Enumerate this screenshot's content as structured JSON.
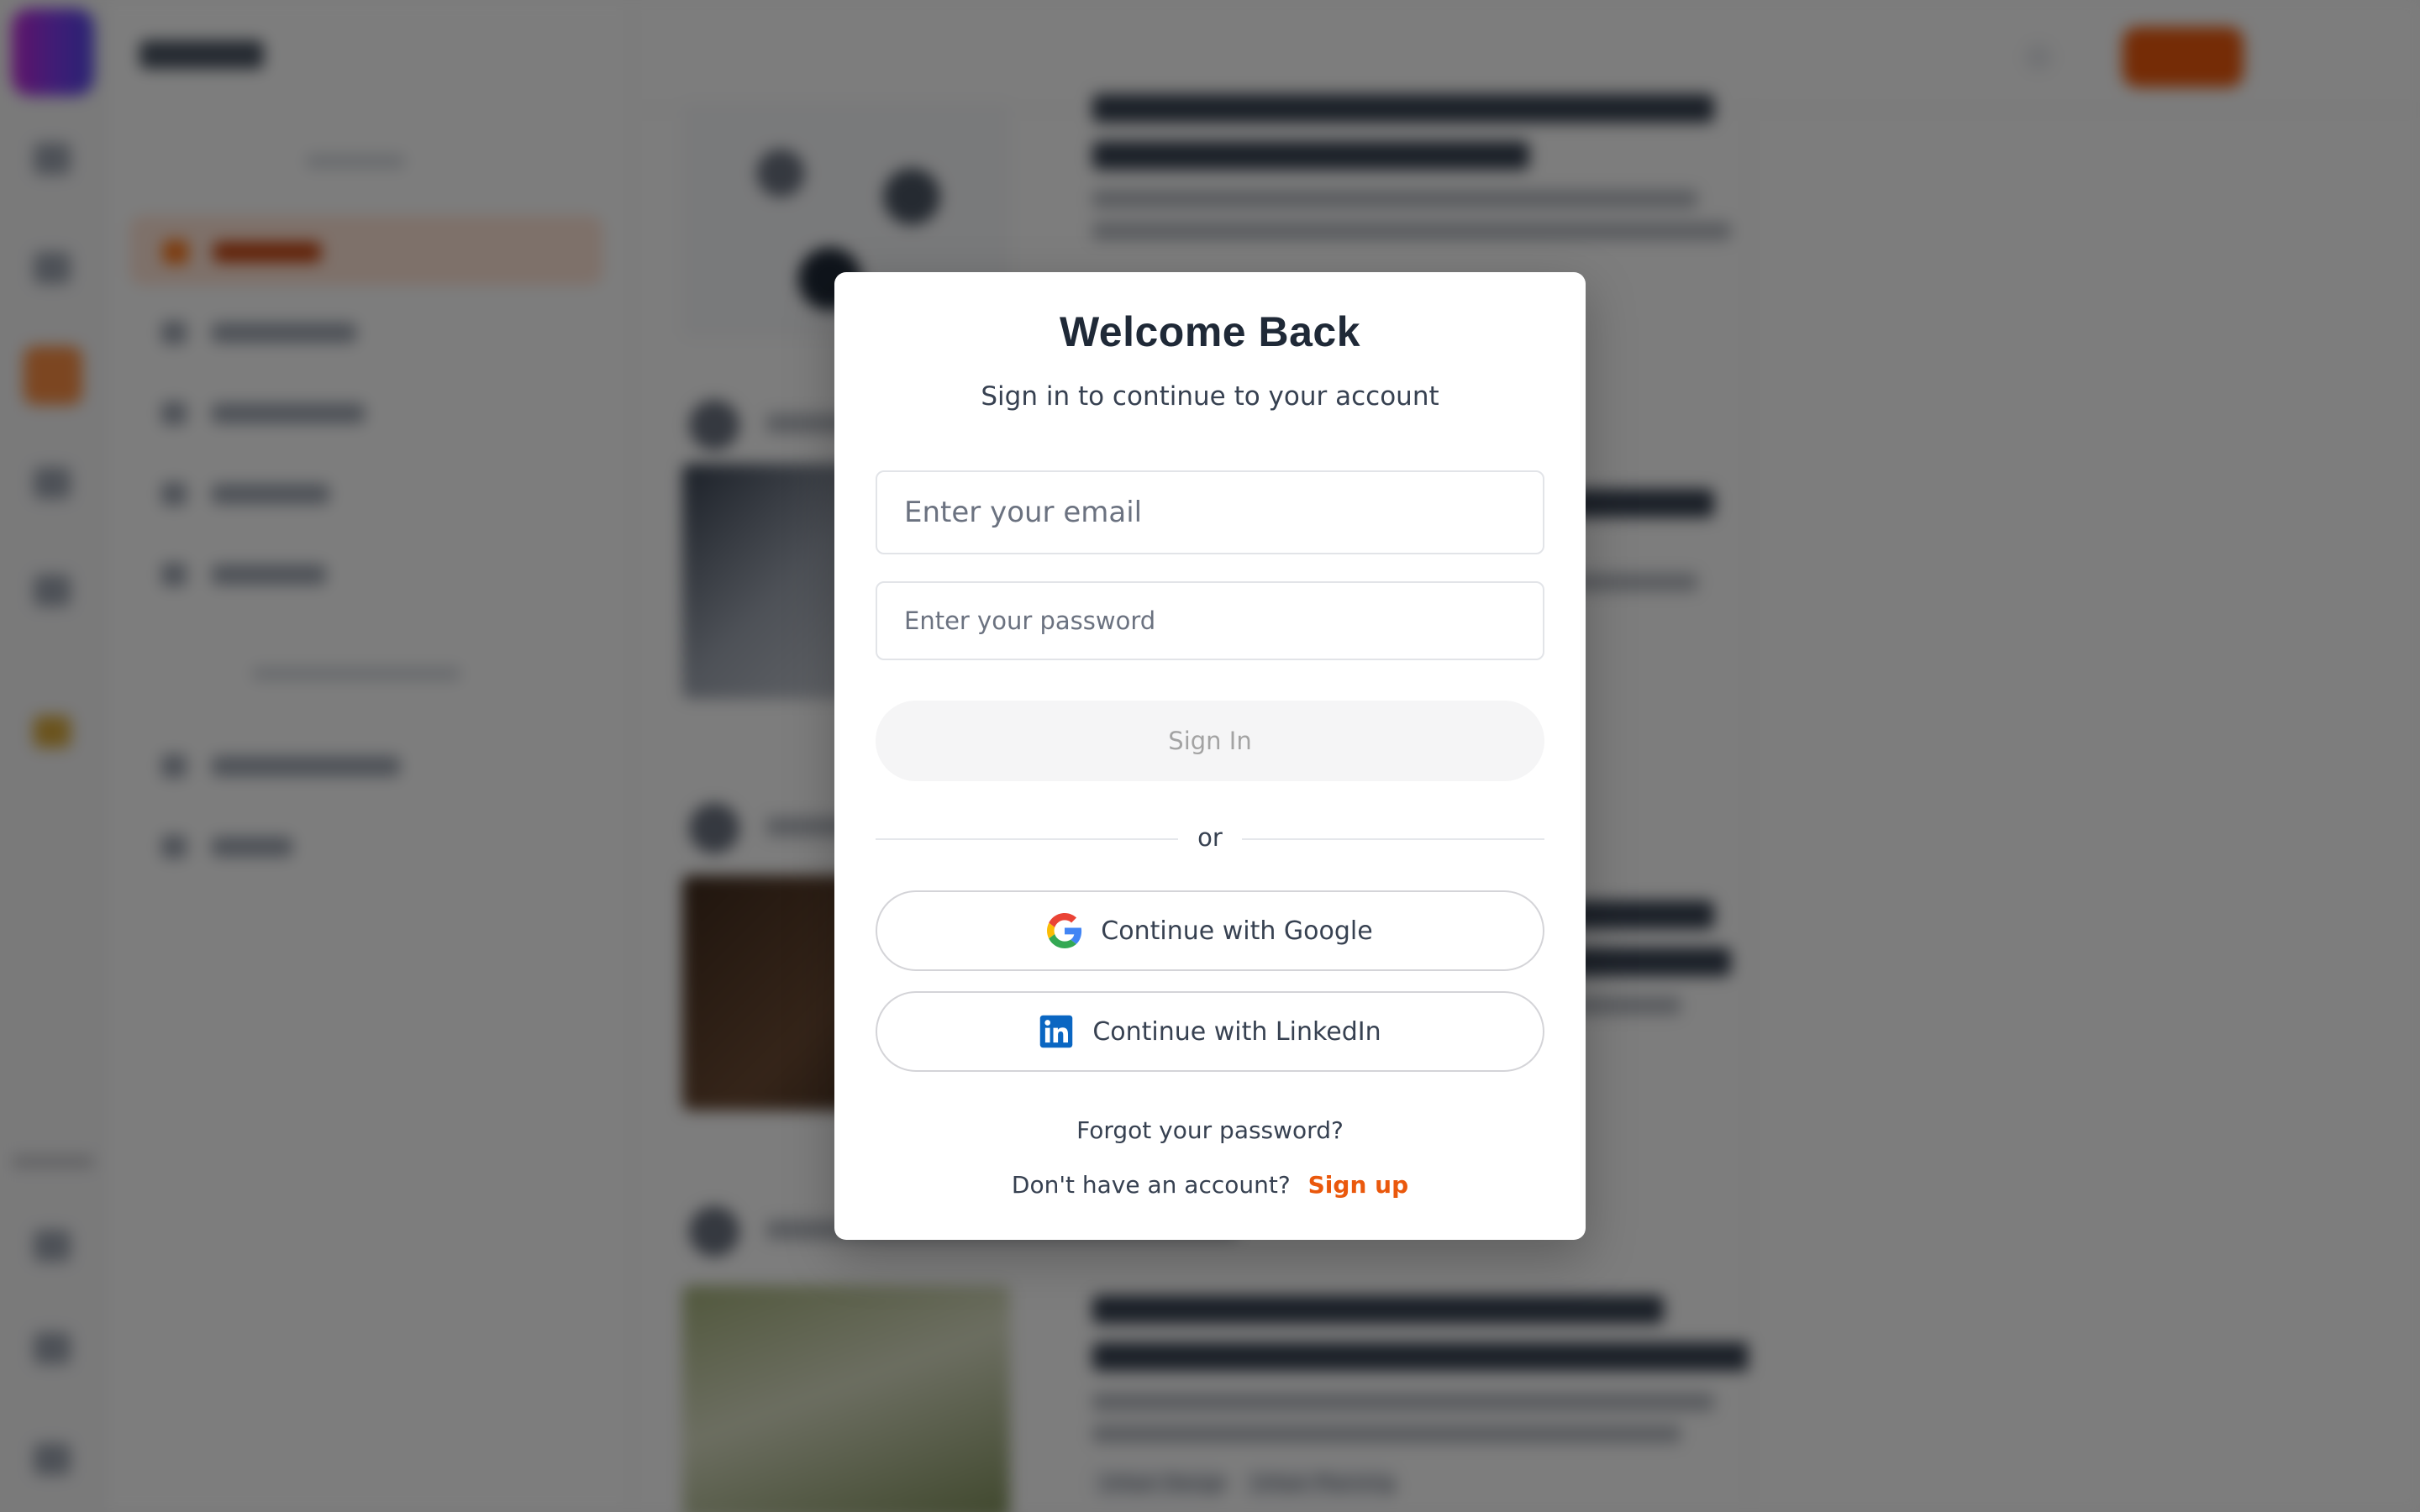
{
  "background": {
    "tags": [
      "Urban Design",
      "Urban Planning"
    ]
  },
  "modal": {
    "title": "Welcome Back",
    "subtitle": "Sign in to continue to your account",
    "email_placeholder": "Enter your email",
    "password_placeholder": "Enter your password",
    "signin_label": "Sign In",
    "or_label": "or",
    "google_label": "Continue with Google",
    "linkedin_label": "Continue with LinkedIn",
    "forgot_label": "Forgot your password?",
    "no_account_label": "Don't have an account?",
    "signup_label": "Sign up"
  },
  "colors": {
    "accent": "#ea580c",
    "overlay": "rgba(0,0,0,0.5)",
    "google_blue": "#4285F4",
    "google_red": "#EA4335",
    "google_yellow": "#FBBC05",
    "google_green": "#34A853",
    "linkedin_blue": "#0A66C2"
  },
  "icons": {
    "google": "google-logo-icon",
    "linkedin": "linkedin-logo-icon"
  }
}
